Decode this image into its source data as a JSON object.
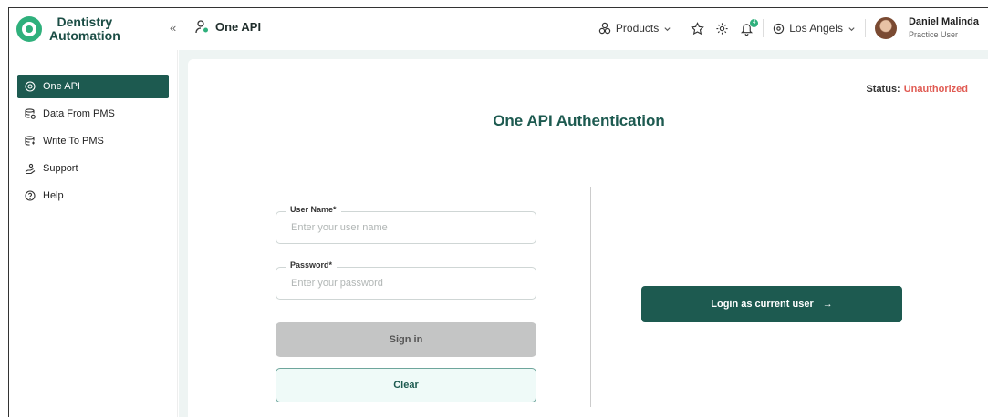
{
  "app": {
    "name_line1": "Dentistry",
    "name_line2": "Automation"
  },
  "header": {
    "collapse_glyph": "«",
    "page_title": "One API",
    "products_label": "Products",
    "location": "Los Angels",
    "user_name": "Daniel Malinda",
    "user_role": "Practice User",
    "notification_count": "4"
  },
  "sidebar": {
    "items": [
      {
        "label": "One API",
        "icon": "api-icon",
        "active": true
      },
      {
        "label": "Data From PMS",
        "icon": "database-icon"
      },
      {
        "label": "Write To PMS",
        "icon": "database-write-icon"
      },
      {
        "label": "Support",
        "icon": "support-hand-icon"
      },
      {
        "label": "Help",
        "icon": "help-circle-icon"
      }
    ]
  },
  "main": {
    "status_label": "Status:",
    "status_value": "Unauthorized",
    "title": "One API Authentication",
    "username_label": "User Name*",
    "username_placeholder": "Enter your user name",
    "password_label": "Password*",
    "password_placeholder": "Enter your password",
    "signin_label": "Sign in",
    "clear_label": "Clear",
    "login_current_label": "Login as current user",
    "login_arrow": "→"
  },
  "colors": {
    "brand": "#1d5a50",
    "accent": "#2fb07c",
    "status_error": "#e05a52"
  }
}
